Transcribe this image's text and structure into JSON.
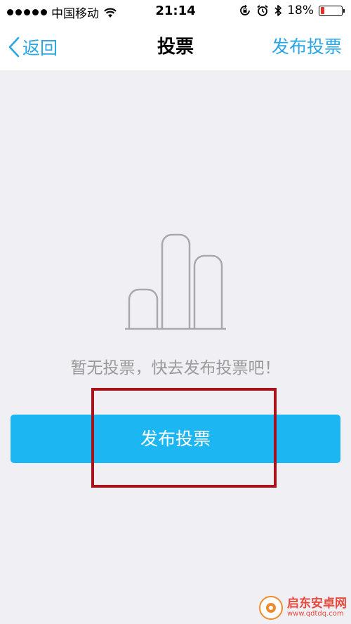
{
  "status_bar": {
    "carrier": "中国移动",
    "time": "21:14",
    "battery_percent": "18%",
    "battery_level": 0.18,
    "battery_color": "#e0322b",
    "icons": [
      "signal-dots-icon",
      "wifi-icon",
      "orientation-lock-icon",
      "alarm-icon",
      "bluetooth-icon",
      "battery-icon"
    ]
  },
  "nav": {
    "back_label": "返回",
    "title": "投票",
    "right_action": "发布投票"
  },
  "empty_state": {
    "illustration_icon": "bar-chart-icon",
    "message": "暂无投票，快去发布投票吧！"
  },
  "primary_button": {
    "label": "发布投票",
    "color": "#1cb7f3"
  },
  "annotation": {
    "highlight_color": "#a8131b"
  },
  "watermark": {
    "name": "启东安卓网",
    "url": "www.qdtdq.com",
    "logo_icon": "watermark-logo-icon"
  },
  "colors": {
    "accent": "#2aa6e6",
    "background": "#efeff4"
  }
}
